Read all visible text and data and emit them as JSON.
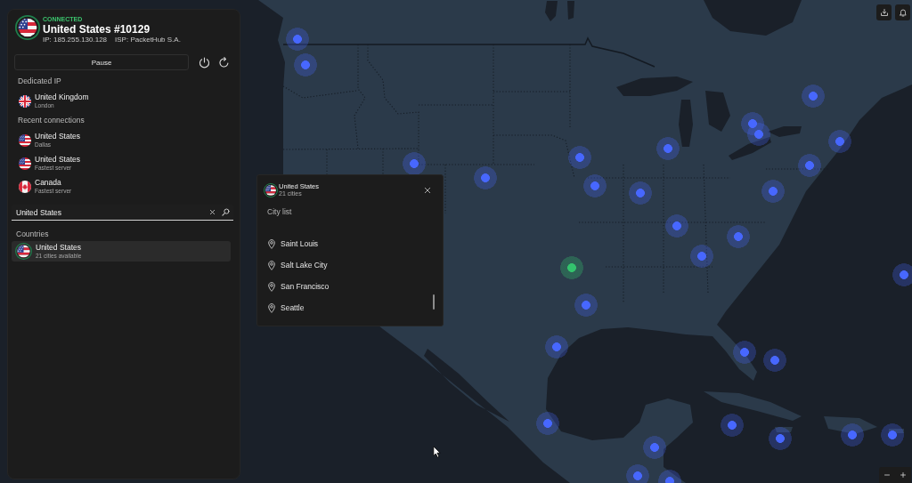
{
  "status": {
    "state": "CONNECTED",
    "server": "United States #10129",
    "ip": "IP: 185.255.130.128",
    "isp": "ISP: PacketHub S.A.",
    "kind": "us",
    "connected": true
  },
  "controls": {
    "pause_label": "Pause"
  },
  "dedicated_ip": {
    "heading": "Dedicated IP",
    "items": [
      {
        "kind": "uk",
        "name": "United Kingdom",
        "detail": "London"
      }
    ]
  },
  "recent": {
    "heading": "Recent connections",
    "items": [
      {
        "kind": "us",
        "name": "United States",
        "detail": "Dallas"
      },
      {
        "kind": "us",
        "name": "United States",
        "detail": "Fastest server"
      },
      {
        "kind": "ca",
        "name": "Canada",
        "detail": "Fastest server"
      }
    ]
  },
  "search": {
    "value": "United States"
  },
  "results": {
    "heading": "Countries",
    "items": [
      {
        "kind": "us",
        "name": "United States",
        "detail": "21 cities available",
        "connected": true,
        "selected": true
      }
    ]
  },
  "city_popup": {
    "kind": "us",
    "connected": true,
    "country": "United States",
    "count": "21 cities",
    "heading": "City list",
    "cities": [
      {
        "name": "Saint Louis",
        "selected": false
      },
      {
        "name": "Salt Lake City",
        "selected": false
      },
      {
        "name": "San Francisco",
        "selected": false
      },
      {
        "name": "Seattle",
        "selected": false
      }
    ]
  },
  "map": {
    "markers": [
      {
        "connected": false
      },
      {
        "connected": false
      },
      {
        "connected": false
      },
      {
        "connected": false
      },
      {
        "connected": false
      },
      {
        "connected": false
      },
      {
        "connected": false
      },
      {
        "connected": false
      },
      {
        "connected": false
      },
      {
        "connected": false
      },
      {
        "connected": false
      },
      {
        "connected": false
      },
      {
        "connected": false
      },
      {
        "connected": false
      },
      {
        "connected": false
      },
      {
        "connected": false
      },
      {
        "connected": false
      },
      {
        "connected": true
      },
      {
        "connected": false
      },
      {
        "connected": false
      },
      {
        "connected": false
      },
      {
        "connected": false
      },
      {
        "connected": false
      },
      {
        "connected": false
      },
      {
        "connected": false
      },
      {
        "connected": false
      },
      {
        "connected": false
      },
      {
        "connected": false
      },
      {
        "connected": false
      },
      {
        "connected": false
      },
      {
        "connected": false
      }
    ]
  }
}
